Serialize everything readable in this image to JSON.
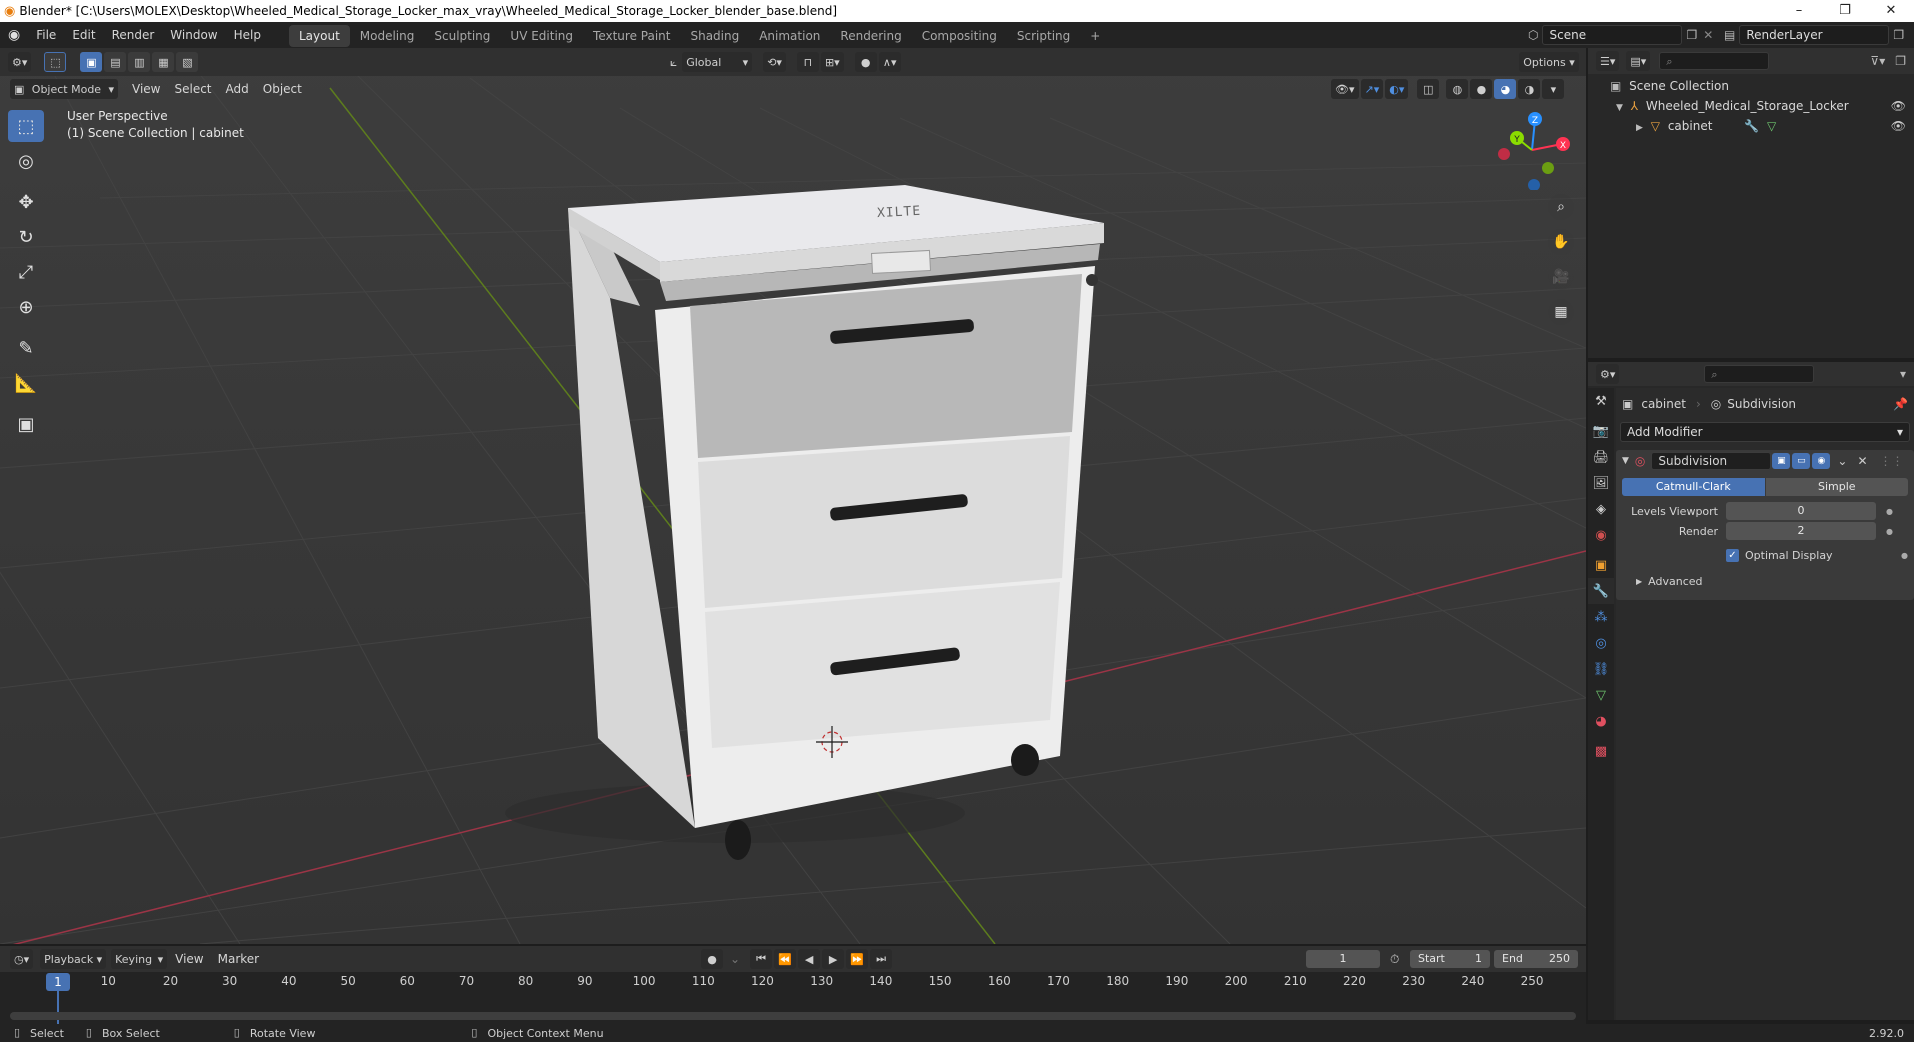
{
  "window": {
    "title": "Blender* [C:\\Users\\MOLEX\\Desktop\\Wheeled_Medical_Storage_Locker_max_vray\\Wheeled_Medical_Storage_Locker_blender_base.blend]",
    "minimize": "–",
    "restore": "❐",
    "close": "✕"
  },
  "menu": {
    "file": "File",
    "edit": "Edit",
    "render": "Render",
    "window": "Window",
    "help": "Help"
  },
  "workspaces": [
    "Layout",
    "Modeling",
    "Sculpting",
    "UV Editing",
    "Texture Paint",
    "Shading",
    "Animation",
    "Rendering",
    "Compositing",
    "Scripting"
  ],
  "workspace_add": "+",
  "scene": {
    "name": "Scene",
    "render_layer": "RenderLayer"
  },
  "tool_header": {
    "transform_orientation": "Global",
    "options": "Options"
  },
  "viewport_header": {
    "mode": "Object Mode",
    "view": "View",
    "select": "Select",
    "add": "Add",
    "object": "Object"
  },
  "viewport": {
    "perspective": "User Perspective",
    "collection_info": "(1) Scene Collection | cabinet",
    "logo_text": "XILTE",
    "gizmo": {
      "x": "X",
      "y": "Y",
      "z": "Z"
    }
  },
  "outliner": {
    "root": "Scene Collection",
    "collection": "Wheeled_Medical_Storage_Locker",
    "object": "cabinet"
  },
  "properties": {
    "object_name": "cabinet",
    "modifier_breadcrumb": "Subdivision",
    "add_modifier": "Add Modifier",
    "modifier": {
      "name": "Subdivision",
      "mode_catmull": "Catmull-Clark",
      "mode_simple": "Simple",
      "levels_viewport_label": "Levels Viewport",
      "levels_viewport": "0",
      "render_label": "Render",
      "render_value": "2",
      "optimal_display": "Optimal Display",
      "optimal_display_checked": true,
      "advanced": "Advanced"
    }
  },
  "timeline": {
    "playback": "Playback",
    "keying": "Keying",
    "view": "View",
    "marker": "Marker",
    "current_frame": "1",
    "start_label": "Start",
    "start": "1",
    "end_label": "End",
    "end": "250",
    "ticks": [
      "1",
      "10",
      "20",
      "30",
      "40",
      "50",
      "60",
      "70",
      "80",
      "90",
      "100",
      "110",
      "120",
      "130",
      "140",
      "150",
      "160",
      "170",
      "180",
      "190",
      "200",
      "210",
      "220",
      "230",
      "240",
      "250"
    ]
  },
  "status": {
    "select": "Select",
    "box_select": "Box Select",
    "rotate_view": "Rotate View",
    "context_menu": "Object Context Menu",
    "version": "2.92.0"
  },
  "colors": {
    "accent": "#4772b3",
    "x_axis": "#ff3352",
    "y_axis": "#8bdc00",
    "z_axis": "#2890ff"
  }
}
